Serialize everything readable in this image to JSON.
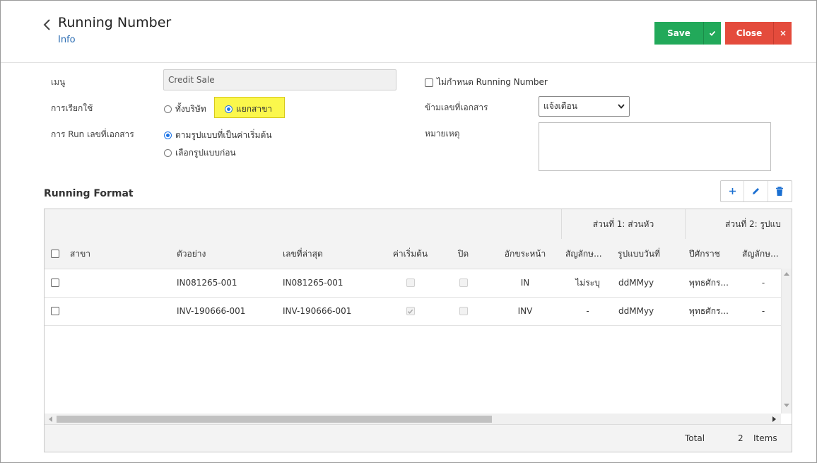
{
  "header": {
    "title": "Running Number",
    "subtitle": "Info",
    "save_label": "Save",
    "close_label": "Close"
  },
  "form": {
    "menu_label": "เมนู",
    "menu_value": "Credit Sale",
    "usage_label": "การเรียกใช้",
    "usage_options": [
      "ทั้งบริษัท",
      "แยกสาขา"
    ],
    "usage_selected": "แยกสาขา",
    "run_label": "การ Run เลขที่เอกสาร",
    "run_options": [
      "ตามรูปแบบที่เป็นค่าเริ่มต้น",
      "เลือกรูปแบบก่อน"
    ],
    "run_selected": "ตามรูปแบบที่เป็นค่าเริ่มต้น",
    "no_running_label": "ไม่กำหนด Running Number",
    "skip_label": "ข้ามเลขที่เอกสาร",
    "skip_value": "แจ้งเตือน",
    "remark_label": "หมายเหตุ"
  },
  "grid": {
    "title": "Running Format",
    "band_headers": [
      "ส่วนที่ 1: ส่วนหัว",
      "ส่วนที่ 2: รูปแบ"
    ],
    "columns": [
      "สาขา",
      "ตัวอย่าง",
      "เลขที่ล่าสุด",
      "ค่าเริ่มต้น",
      "ปิด",
      "อักขระหน้า",
      "สัญลักษ...",
      "รูปแบบวันที่",
      "ปีศักราช",
      "สัญลักษ..."
    ],
    "rows": [
      {
        "branch": "",
        "example": "IN081265-001",
        "latest": "IN081265-001",
        "default": false,
        "closed": false,
        "prefix": "IN",
        "symbol": "ไม่ระบุ",
        "date_format": "ddMMyy",
        "era": "พุทธศักร...",
        "symbol2": "-"
      },
      {
        "branch": "",
        "example": "INV-190666-001",
        "latest": "INV-190666-001",
        "default": true,
        "closed": false,
        "prefix": "INV",
        "symbol": "-",
        "date_format": "ddMMyy",
        "era": "พุทธศักร...",
        "symbol2": "-"
      }
    ],
    "footer": {
      "total_label": "Total",
      "count": "2",
      "items_label": "Items"
    }
  },
  "colors": {
    "save": "#22a95a",
    "close": "#e44b3c",
    "accent": "#1a73e8",
    "highlight": "#fbf74c",
    "link": "#2c6db3"
  }
}
